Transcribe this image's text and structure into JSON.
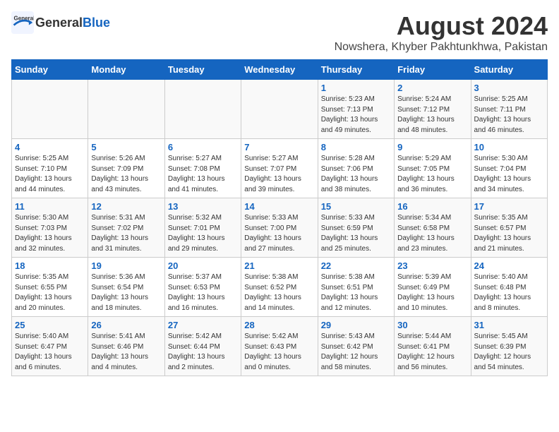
{
  "header": {
    "logo_general": "General",
    "logo_blue": "Blue",
    "month_title": "August 2024",
    "subtitle": "Nowshera, Khyber Pakhtunkhwa, Pakistan"
  },
  "weekdays": [
    "Sunday",
    "Monday",
    "Tuesday",
    "Wednesday",
    "Thursday",
    "Friday",
    "Saturday"
  ],
  "weeks": [
    [
      {
        "day": "",
        "info": ""
      },
      {
        "day": "",
        "info": ""
      },
      {
        "day": "",
        "info": ""
      },
      {
        "day": "",
        "info": ""
      },
      {
        "day": "1",
        "info": "Sunrise: 5:23 AM\nSunset: 7:13 PM\nDaylight: 13 hours\nand 49 minutes."
      },
      {
        "day": "2",
        "info": "Sunrise: 5:24 AM\nSunset: 7:12 PM\nDaylight: 13 hours\nand 48 minutes."
      },
      {
        "day": "3",
        "info": "Sunrise: 5:25 AM\nSunset: 7:11 PM\nDaylight: 13 hours\nand 46 minutes."
      }
    ],
    [
      {
        "day": "4",
        "info": "Sunrise: 5:25 AM\nSunset: 7:10 PM\nDaylight: 13 hours\nand 44 minutes."
      },
      {
        "day": "5",
        "info": "Sunrise: 5:26 AM\nSunset: 7:09 PM\nDaylight: 13 hours\nand 43 minutes."
      },
      {
        "day": "6",
        "info": "Sunrise: 5:27 AM\nSunset: 7:08 PM\nDaylight: 13 hours\nand 41 minutes."
      },
      {
        "day": "7",
        "info": "Sunrise: 5:27 AM\nSunset: 7:07 PM\nDaylight: 13 hours\nand 39 minutes."
      },
      {
        "day": "8",
        "info": "Sunrise: 5:28 AM\nSunset: 7:06 PM\nDaylight: 13 hours\nand 38 minutes."
      },
      {
        "day": "9",
        "info": "Sunrise: 5:29 AM\nSunset: 7:05 PM\nDaylight: 13 hours\nand 36 minutes."
      },
      {
        "day": "10",
        "info": "Sunrise: 5:30 AM\nSunset: 7:04 PM\nDaylight: 13 hours\nand 34 minutes."
      }
    ],
    [
      {
        "day": "11",
        "info": "Sunrise: 5:30 AM\nSunset: 7:03 PM\nDaylight: 13 hours\nand 32 minutes."
      },
      {
        "day": "12",
        "info": "Sunrise: 5:31 AM\nSunset: 7:02 PM\nDaylight: 13 hours\nand 31 minutes."
      },
      {
        "day": "13",
        "info": "Sunrise: 5:32 AM\nSunset: 7:01 PM\nDaylight: 13 hours\nand 29 minutes."
      },
      {
        "day": "14",
        "info": "Sunrise: 5:33 AM\nSunset: 7:00 PM\nDaylight: 13 hours\nand 27 minutes."
      },
      {
        "day": "15",
        "info": "Sunrise: 5:33 AM\nSunset: 6:59 PM\nDaylight: 13 hours\nand 25 minutes."
      },
      {
        "day": "16",
        "info": "Sunrise: 5:34 AM\nSunset: 6:58 PM\nDaylight: 13 hours\nand 23 minutes."
      },
      {
        "day": "17",
        "info": "Sunrise: 5:35 AM\nSunset: 6:57 PM\nDaylight: 13 hours\nand 21 minutes."
      }
    ],
    [
      {
        "day": "18",
        "info": "Sunrise: 5:35 AM\nSunset: 6:55 PM\nDaylight: 13 hours\nand 20 minutes."
      },
      {
        "day": "19",
        "info": "Sunrise: 5:36 AM\nSunset: 6:54 PM\nDaylight: 13 hours\nand 18 minutes."
      },
      {
        "day": "20",
        "info": "Sunrise: 5:37 AM\nSunset: 6:53 PM\nDaylight: 13 hours\nand 16 minutes."
      },
      {
        "day": "21",
        "info": "Sunrise: 5:38 AM\nSunset: 6:52 PM\nDaylight: 13 hours\nand 14 minutes."
      },
      {
        "day": "22",
        "info": "Sunrise: 5:38 AM\nSunset: 6:51 PM\nDaylight: 13 hours\nand 12 minutes."
      },
      {
        "day": "23",
        "info": "Sunrise: 5:39 AM\nSunset: 6:49 PM\nDaylight: 13 hours\nand 10 minutes."
      },
      {
        "day": "24",
        "info": "Sunrise: 5:40 AM\nSunset: 6:48 PM\nDaylight: 13 hours\nand 8 minutes."
      }
    ],
    [
      {
        "day": "25",
        "info": "Sunrise: 5:40 AM\nSunset: 6:47 PM\nDaylight: 13 hours\nand 6 minutes."
      },
      {
        "day": "26",
        "info": "Sunrise: 5:41 AM\nSunset: 6:46 PM\nDaylight: 13 hours\nand 4 minutes."
      },
      {
        "day": "27",
        "info": "Sunrise: 5:42 AM\nSunset: 6:44 PM\nDaylight: 13 hours\nand 2 minutes."
      },
      {
        "day": "28",
        "info": "Sunrise: 5:42 AM\nSunset: 6:43 PM\nDaylight: 13 hours\nand 0 minutes."
      },
      {
        "day": "29",
        "info": "Sunrise: 5:43 AM\nSunset: 6:42 PM\nDaylight: 12 hours\nand 58 minutes."
      },
      {
        "day": "30",
        "info": "Sunrise: 5:44 AM\nSunset: 6:41 PM\nDaylight: 12 hours\nand 56 minutes."
      },
      {
        "day": "31",
        "info": "Sunrise: 5:45 AM\nSunset: 6:39 PM\nDaylight: 12 hours\nand 54 minutes."
      }
    ]
  ]
}
